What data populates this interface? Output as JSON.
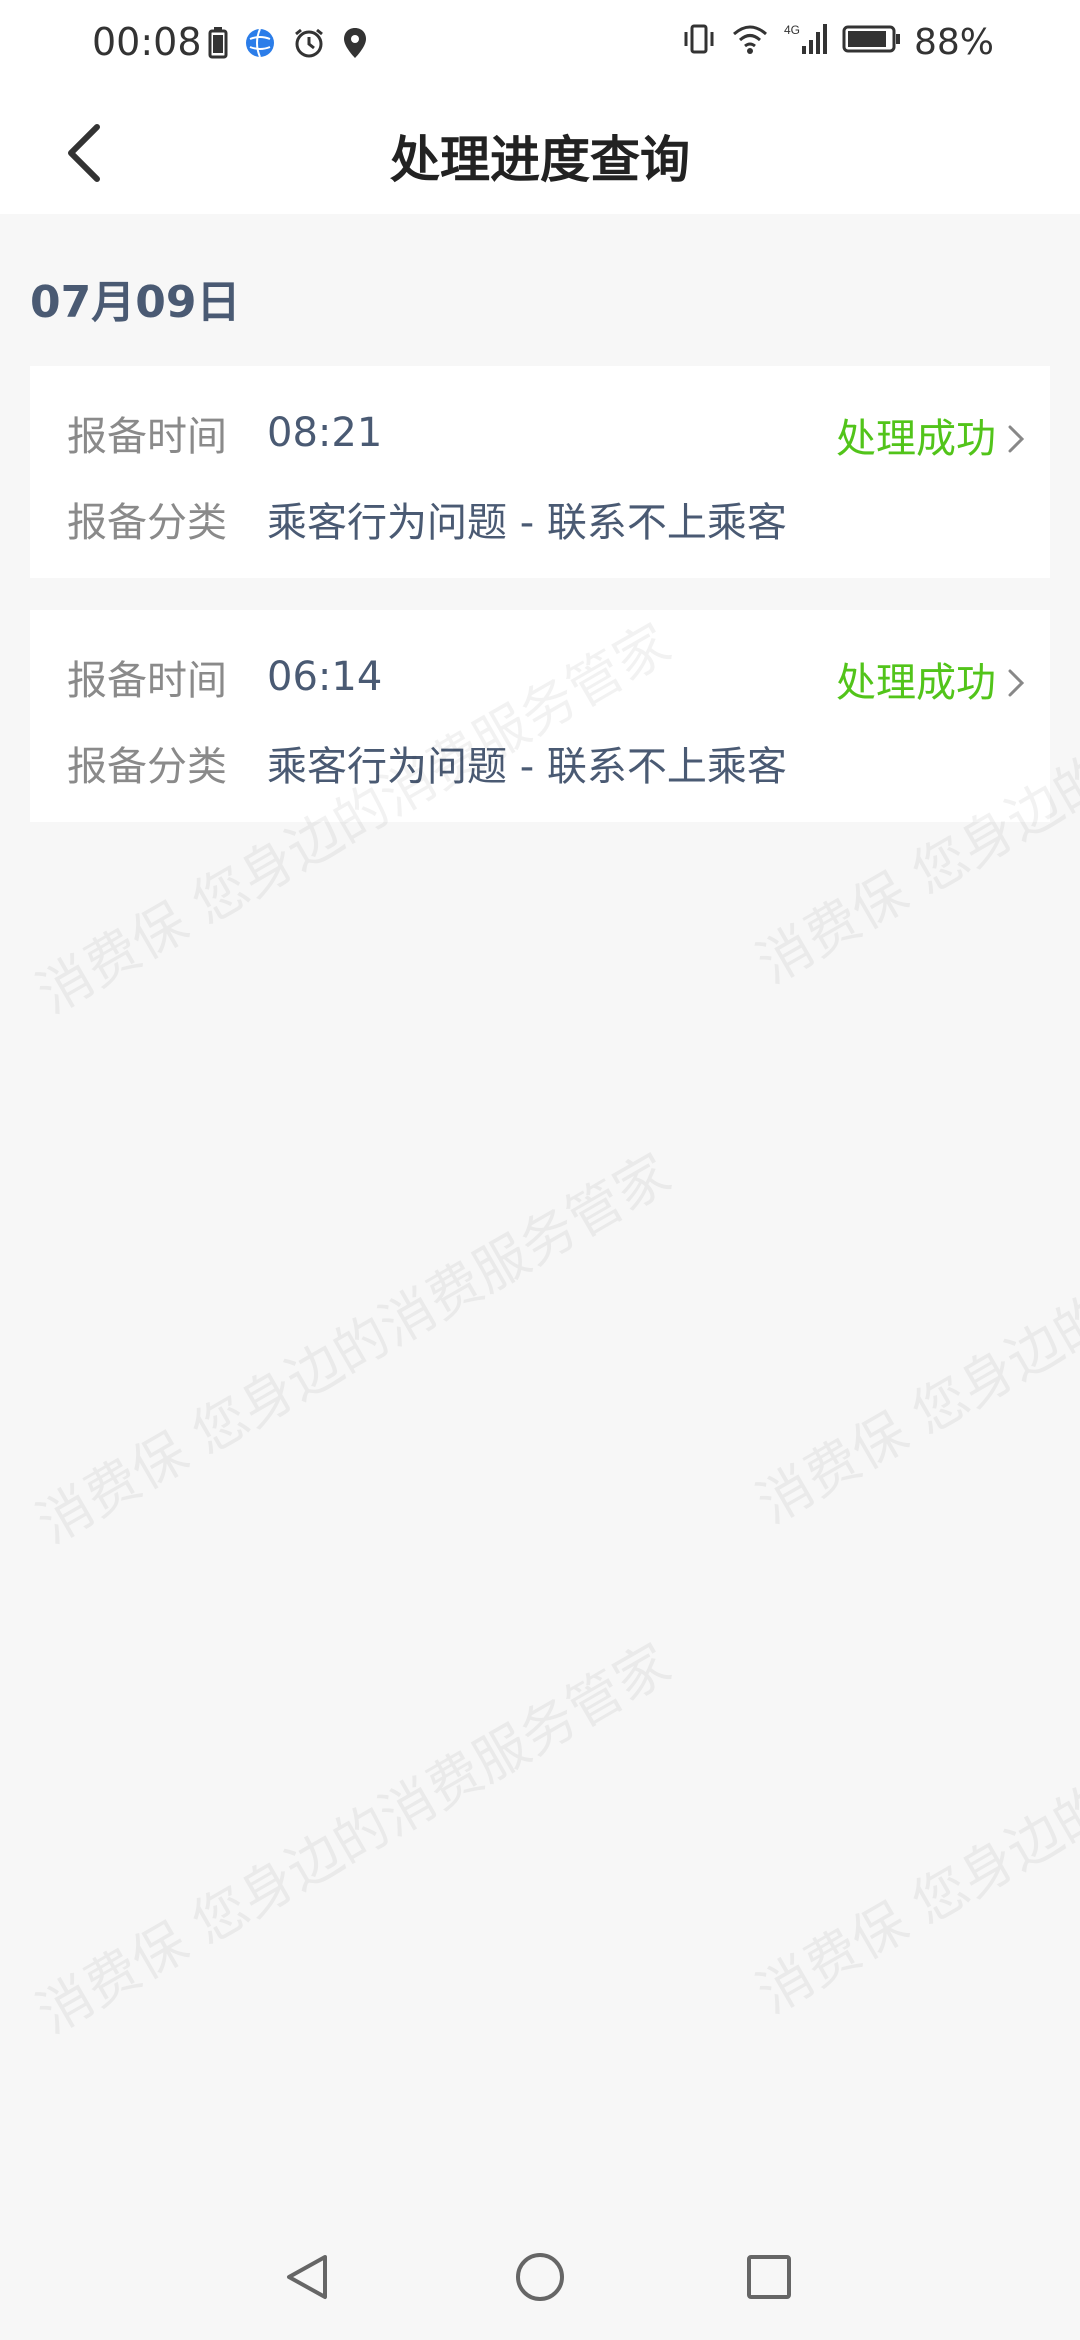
{
  "status_bar": {
    "time": "00:08",
    "battery": "88%",
    "icons_left": [
      "battery-saver-icon",
      "browser-icon",
      "alarm-icon",
      "location-icon"
    ],
    "icons_right": [
      "vibrate-icon",
      "wifi-icon",
      "signal-4g-icon",
      "battery-icon"
    ]
  },
  "header": {
    "title": "处理进度查询"
  },
  "list": {
    "date": "07月09日",
    "items": [
      {
        "time_label": "报备时间",
        "time_value": "08:21",
        "category_label": "报备分类",
        "category_value": "乘客行为问题 - 联系不上乘客",
        "status": "处理成功"
      },
      {
        "time_label": "报备时间",
        "time_value": "06:14",
        "category_label": "报备分类",
        "category_value": "乘客行为问题 - 联系不上乘客",
        "status": "处理成功"
      }
    ]
  },
  "watermark": {
    "text": "消费保 您身边的消费服务管家"
  },
  "colors": {
    "accent_green": "#52c41a",
    "value_blue_gray": "#4a5a73",
    "label_gray": "#8a8a8a",
    "background": "#f7f7f7"
  }
}
